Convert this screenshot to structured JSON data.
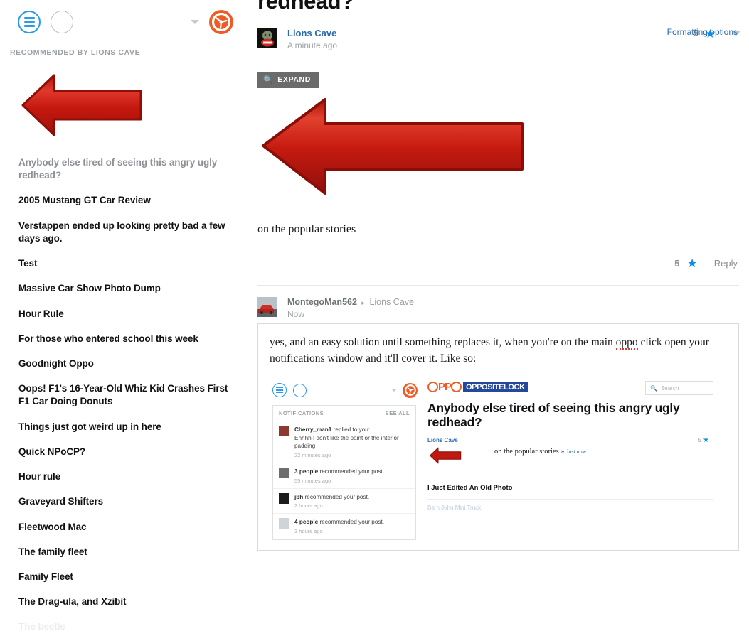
{
  "sidebar": {
    "hamburger_label": "menu",
    "avatar_label": "user-avatar",
    "caret_label": "expand",
    "brand_label": "oppositelock-wheel",
    "recommended_header": "RECOMMENDED BY LIONS CAVE",
    "thumb_alt": "red-left-arrow",
    "items": [
      {
        "label": "Anybody else tired of seeing this angry ugly redhead?",
        "state": "muted"
      },
      {
        "label": "2005 Mustang GT Car Review",
        "state": "normal"
      },
      {
        "label": "Verstappen ended up looking pretty bad a few days ago.",
        "state": "normal"
      },
      {
        "label": "Test",
        "state": "normal"
      },
      {
        "label": "Massive Car Show Photo Dump",
        "state": "normal"
      },
      {
        "label": "Hour Rule",
        "state": "normal"
      },
      {
        "label": "For those who entered school this week",
        "state": "normal"
      },
      {
        "label": "Goodnight Oppo",
        "state": "normal"
      },
      {
        "label": "Oops! F1's 16-Year-Old Whiz Kid Crashes First F1 Car Doing Donuts",
        "state": "normal"
      },
      {
        "label": "Things just got weird up in here",
        "state": "normal"
      },
      {
        "label": "Quick NPoCP?",
        "state": "normal"
      },
      {
        "label": "Hour rule",
        "state": "normal"
      },
      {
        "label": "Graveyard Shifters",
        "state": "normal"
      },
      {
        "label": "Fleetwood Mac",
        "state": "normal"
      },
      {
        "label": "The family fleet",
        "state": "normal"
      },
      {
        "label": "Family Fleet",
        "state": "normal"
      },
      {
        "label": "The Drag-ula, and Xzibit",
        "state": "normal"
      },
      {
        "label": "The beetle",
        "state": "fade"
      }
    ]
  },
  "post": {
    "title": "redhead?",
    "author": "Lions Cave",
    "timestamp": "A minute ago",
    "score": "5",
    "star_glyph": "★",
    "expand_label": "EXPAND",
    "expand_icon": "⌕",
    "image_alt": "red-left-arrow",
    "body": "on the popular stories",
    "reply_score": "5",
    "reply_label": "Reply"
  },
  "comment": {
    "author": "MontegoMan562",
    "separator": "▸",
    "parent": "Lions Cave",
    "timestamp": "Now",
    "formatting_options": "Formatting options",
    "text_before_spell": "yes, and an easy solution until something replaces it, when you're on the main ",
    "spell_word": "oppo",
    "text_after_spell": " click open your notifications window and it'll cover it. Like so:"
  },
  "embedded": {
    "notifications": {
      "header": "NOTIFICATIONS",
      "see_all": "SEE ALL",
      "items": [
        {
          "actor": "Cherry_man1",
          "action": " replied to you:",
          "detail": "Ehhhh I don't like the paint or the interior padding",
          "time": "22 minutes ago"
        },
        {
          "actor": "3 people",
          "action": " recommended your post.",
          "detail": "",
          "time": "55 minutes ago"
        },
        {
          "actor": "jbh",
          "action": " recommended your post.",
          "detail": "",
          "time": "2 hours ago"
        },
        {
          "actor": "4 people",
          "action": " recommended your post.",
          "detail": "",
          "time": "3 hours ago"
        }
      ]
    },
    "brand_oppo": "PP",
    "brand_tag": "OPPOSITELOCK",
    "search_placeholder": "Search",
    "search_icon": "⌕",
    "title": "Anybody else tired of seeing this angry ugly redhead?",
    "author": "Lions Cave",
    "score": "5",
    "star_glyph": "★",
    "line_text": "on the popular stories",
    "line_chevron": "»",
    "line_time": "Just now",
    "next_post": "I Just Edited An Old Photo",
    "next_faint": "Barn John Mini Truck"
  },
  "colors": {
    "accent_blue": "#2b9ae8",
    "star_blue": "#0f8de8",
    "brand_orange": "#ef5b25",
    "link_blue": "#2b6cb0",
    "tag_navy": "#23489c",
    "arrow_red": "#c01a12"
  }
}
